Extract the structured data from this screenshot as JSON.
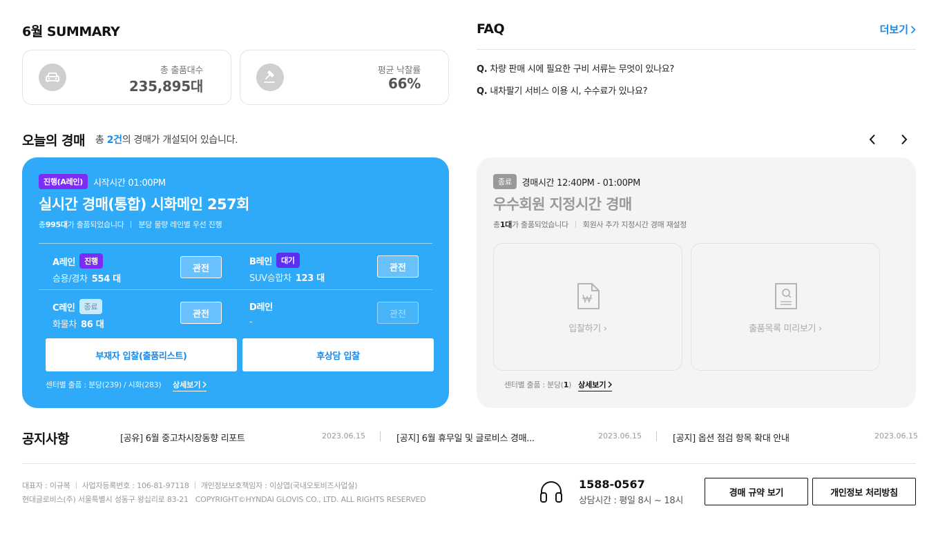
{
  "summary": {
    "title": "6월 SUMMARY",
    "cards": [
      {
        "label": "총 출품대수",
        "value": "235,895대",
        "icon": "car-icon"
      },
      {
        "label": "평균 낙찰률",
        "value": "66%",
        "icon": "gavel-icon"
      }
    ]
  },
  "faq": {
    "title": "FAQ",
    "more_label": "더보기",
    "items": [
      {
        "q": "Q.",
        "text": "차량 판매 시에 필요한 구비 서류는 무엇이 있나요?"
      },
      {
        "q": "Q.",
        "text": "내차팔기 서비스 이용 시, 수수료가 있나요?"
      }
    ]
  },
  "today": {
    "title": "오늘의 경매",
    "sub_prefix": "총 ",
    "sub_count": "2건",
    "sub_suffix": "의 경매가 개설되어 있습니다."
  },
  "auction_live": {
    "badge": "진행(A레인)",
    "start_time": "시작시간 01:00PM",
    "title": "실시간 경매(통합) 시화메인 257회",
    "info_prefix": "총 ",
    "info_count": "995대",
    "info_suffix": "가 출품되었습니다",
    "info_note": "분당 물량 레인별 우선 진행",
    "lanes": [
      {
        "name": "A레인",
        "status": "진행",
        "desc": "승용/경차",
        "count": "554 대",
        "watch": "관전"
      },
      {
        "name": "B레인",
        "status": "대기",
        "desc": "SUV승합차",
        "count": "123 대",
        "watch": "관전"
      },
      {
        "name": "C레인",
        "status": "종료",
        "desc": "화물차",
        "count": "86 대",
        "watch": "관전"
      },
      {
        "name": "D레인",
        "status": "",
        "desc": "-",
        "count": "",
        "watch": "관전"
      }
    ],
    "btn_absentee": "부재자 입찰(출품리스트)",
    "btn_post": "후상담 입찰",
    "center_info": "센터별 출품 : 분당(239) / 시화(283)",
    "detail_label": "상세보기"
  },
  "auction_closed": {
    "badge": "종료",
    "time": "경매시간 12:40PM -  01:00PM",
    "title": "우수회원 지정시간 경매",
    "info_prefix": "총 ",
    "info_count": "1대",
    "info_suffix": "가 출품되었습니다",
    "info_note": "회원사 추가 지정시간 경매 재설정",
    "bid_label": "입찰하기",
    "preview_label": "출품목록 미리보기",
    "center_prefix": "센터별 출품 : 분당(",
    "center_count": "1",
    "center_suffix": ")",
    "detail_label": "상세보기"
  },
  "notices": {
    "title": "공지사항",
    "items": [
      {
        "text": "[공유] 6월 중고차시장동향 리포트",
        "date": "2023.06.15"
      },
      {
        "text": "[공지] 6월 휴무일 및 글로비스 경매...",
        "date": "2023.06.15"
      },
      {
        "text": "[공지] 옵션 점검 항목 확대 안내",
        "date": "2023.06.15"
      }
    ]
  },
  "footer": {
    "ceo": "대표자 : 이규복",
    "biz_no": "사업자등록번호 : 106-81-97118",
    "privacy_officer": "개인정보보호책임자 : 이상엽(국내오토비즈사업실)",
    "address": "현대글로비스(주) 서울특별시 성동구 왕십리로 83-21",
    "copyright": "COPYRIGHT©HYNDAI GLOVIS CO., LTD. ALL RIGHTS RESERVED",
    "phone": "1588-0567",
    "hours": "상담시간 : 평일 8시 ~ 18시",
    "btn_rules": "경매 규약 보기",
    "btn_privacy": "개인정보 처리방침"
  },
  "colors": {
    "accent_blue": "#2eaaf8",
    "link_blue": "#1c88e8",
    "purple_badge": "#7b2cf5"
  }
}
